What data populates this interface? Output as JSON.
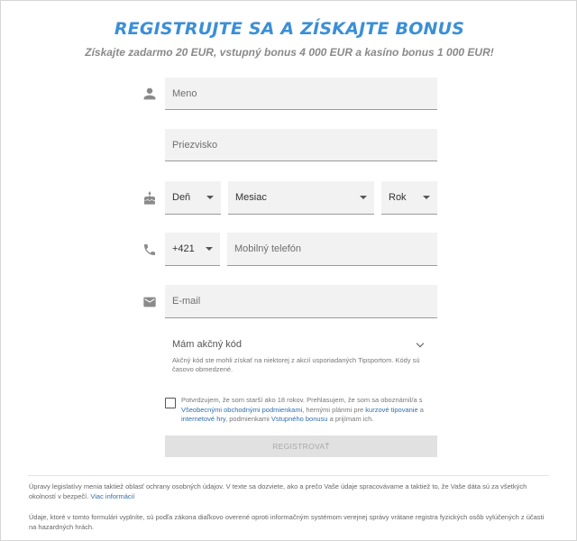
{
  "header": {
    "title": "REGISTRUJTE SA A ZÍSKAJTE BONUS",
    "subtitle": "Získajte zadarmo 20 EUR, vstupný bonus 4 000 EUR a kasíno bonus 1 000 EUR!"
  },
  "form": {
    "first_name": {
      "placeholder": "Meno",
      "value": ""
    },
    "last_name": {
      "placeholder": "Priezvisko",
      "value": ""
    },
    "birth_day": {
      "selected": "Deň"
    },
    "birth_month": {
      "selected": "Mesiac"
    },
    "birth_year": {
      "selected": "Rok"
    },
    "phone_prefix": {
      "selected": "+421"
    },
    "phone": {
      "placeholder": "Mobilný telefón",
      "value": ""
    },
    "email": {
      "placeholder": "E-mail",
      "value": ""
    },
    "promo": {
      "label": "Mám akčný kód",
      "note": "Akčný kód ste mohli získať na niektorej z akcií usporiadaných Tipsportom. Kódy sú časovo obmedzené."
    },
    "consent": {
      "checked": false,
      "text_1": "Potvrdzujem, že som starší ako 18 rokov. Prehlasujem, že som sa oboznámil/a s ",
      "link_terms": "Všeobecnými obchodnými podmienkami",
      "text_2": ", hernými plánmi pre ",
      "link_betting": "kurzové tipovanie",
      "text_3": " a ",
      "link_games": "internetové hry",
      "text_4": ", podmienkami ",
      "link_bonus": "Vstupného bonusu",
      "text_5": " a prijímam ich."
    },
    "submit_label": "REGISTROVAŤ"
  },
  "footer": {
    "privacy_text": "Úpravy legislatívy menia taktiež oblasť ochrany osobných údajov. V texte sa dozviete, ako a prečo Vaše údaje spracovávame a taktiež to, že Vaše dáta sú za všetkých okolností v bezpečí. ",
    "privacy_link": "Viac informácií",
    "verification_text": "Údaje, ktoré v tomto formulári vyplníte, sú podľa zákona diaľkovo overené oproti informačným systémom verejnej správy vrátane registra fyzických osôb vylúčených z účasti na hazardných hrách."
  },
  "icons": {
    "name": "person-icon",
    "birthday": "cake-icon",
    "phone": "phone-icon",
    "email": "envelope-icon"
  },
  "colors": {
    "title": "#3b8fd6",
    "link": "#2f6fae",
    "field_bg": "#f2f2f2",
    "button_disabled": "#e1e1e1"
  }
}
